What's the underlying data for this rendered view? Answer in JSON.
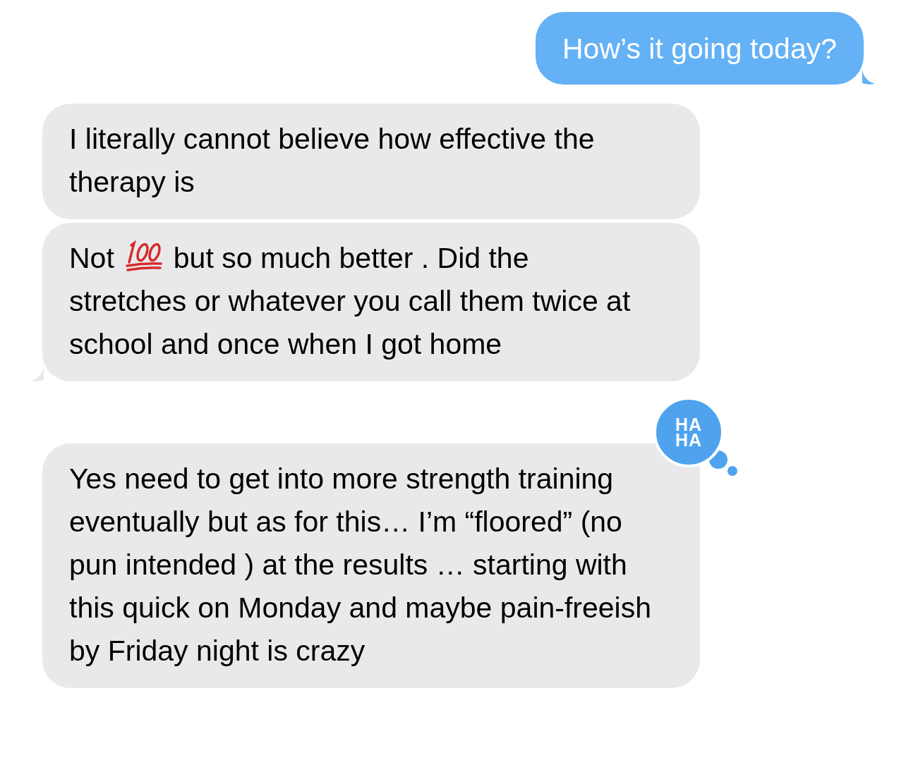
{
  "messages": [
    {
      "kind": "sent",
      "tail": true,
      "segments": [
        {
          "kind": "text",
          "text": "How’s it going today?"
        }
      ]
    },
    {
      "kind": "received",
      "tail": false,
      "segments": [
        {
          "kind": "text",
          "text": "I literally cannot believe how effective the therapy is"
        }
      ]
    },
    {
      "kind": "received",
      "tail": true,
      "segments": [
        {
          "kind": "text",
          "text": "Not",
          "block": false
        },
        {
          "kind": "emoji"
        },
        {
          "kind": "text",
          "text": "but so much better . Did the",
          "block": false
        },
        {
          "kind": "text",
          "text": "stretches or whatever you call them twice at school and once when I got home",
          "block": true
        }
      ]
    },
    {
      "kind": "received",
      "tail": false,
      "tapback": {
        "lines": [
          "HA",
          "HA"
        ]
      },
      "segments": [
        {
          "kind": "text",
          "text": "Yes need to get into more strength training eventually but as for this… I’m “floored” (no pun intended ) at the results … starting with this quick on Monday and maybe pain-freeish by Friday night is crazy"
        }
      ]
    }
  ]
}
